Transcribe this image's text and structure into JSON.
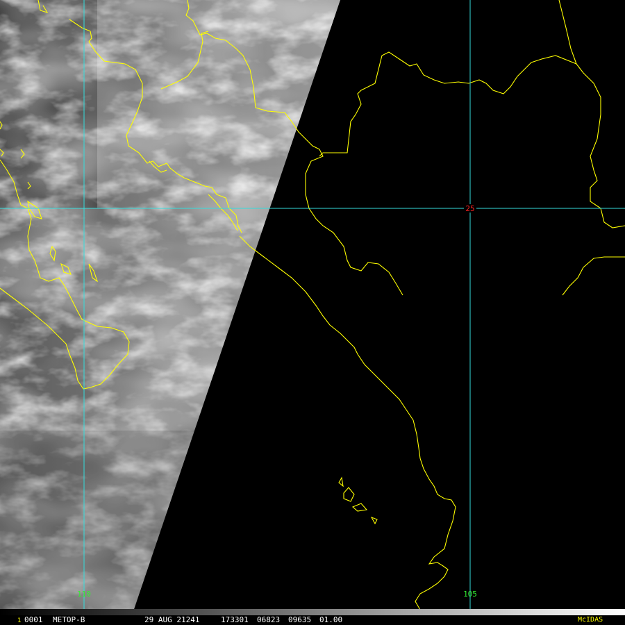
{
  "status_bar": {
    "frame_marker": "1",
    "product_id": "0001",
    "satellite": "METOP-B",
    "date": "29 AUG 21241",
    "time": "173301",
    "field_a": "06823",
    "field_b": "09635",
    "field_c": "01.00",
    "software": "McIDAS"
  },
  "grid": {
    "lat_labels": [
      "25"
    ],
    "lon_labels": [
      "110",
      "105"
    ]
  },
  "colors": {
    "coastline": "#ffff00",
    "gridline": "#33dddd",
    "lat_label": "#ff2222",
    "lon_label": "#33ee33",
    "software_label": "#ffff00",
    "frame_marker": "#ffff00",
    "status_text": "#ffffff"
  },
  "image": {
    "type": "visible satellite imagery",
    "night_side": "black"
  }
}
